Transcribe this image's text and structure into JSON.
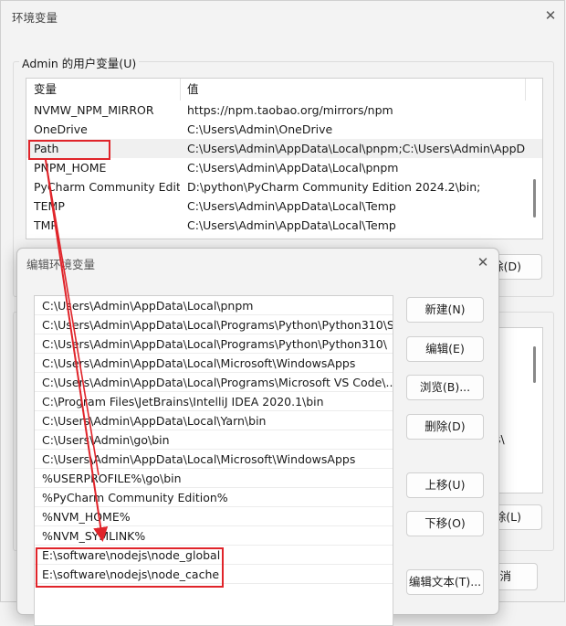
{
  "main_window": {
    "title": "环境变量",
    "user_group_label": "Admin 的用户变量(U)",
    "columns": {
      "name": "变量",
      "value": "值"
    },
    "user_vars": [
      {
        "name": "NVMW_NPM_MIRROR",
        "value": "https://npm.taobao.org/mirrors/npm"
      },
      {
        "name": "OneDrive",
        "value": "C:\\Users\\Admin\\OneDrive"
      },
      {
        "name": "Path",
        "value": "C:\\Users\\Admin\\AppData\\Local\\pnpm;C:\\Users\\Admin\\AppD..."
      },
      {
        "name": "PNPM_HOME",
        "value": "C:\\Users\\Admin\\AppData\\Local\\pnpm"
      },
      {
        "name": "PyCharm Community Editi...",
        "value": "D:\\python\\PyCharm Community Edition 2024.2\\bin;"
      },
      {
        "name": "TEMP",
        "value": "C:\\Users\\Admin\\AppData\\Local\\Temp"
      },
      {
        "name": "TMP",
        "value": "C:\\Users\\Admin\\AppData\\Local\\Temp"
      }
    ],
    "partial_buttons": {
      "delete_user": "除(D)",
      "delete_system": "除(L)",
      "cancel": "消"
    },
    "partial_text": "s\\"
  },
  "edit_dialog": {
    "title": "编辑环境变量",
    "paths": [
      "C:\\Users\\Admin\\AppData\\Local\\pnpm",
      "C:\\Users\\Admin\\AppData\\Local\\Programs\\Python\\Python310\\Sc...",
      "C:\\Users\\Admin\\AppData\\Local\\Programs\\Python\\Python310\\",
      "C:\\Users\\Admin\\AppData\\Local\\Microsoft\\WindowsApps",
      "C:\\Users\\Admin\\AppData\\Local\\Programs\\Microsoft VS Code\\...",
      "C:\\Program Files\\JetBrains\\IntelliJ IDEA 2020.1\\bin",
      "C:\\Users\\Admin\\AppData\\Local\\Yarn\\bin",
      "C:\\Users\\Admin\\go\\bin",
      "C:\\Users\\Admin\\AppData\\Local\\Microsoft\\WindowsApps",
      "%USERPROFILE%\\go\\bin",
      "%PyCharm Community Edition%",
      "%NVM_HOME%",
      "%NVM_SYMLINK%",
      "E:\\software\\nodejs\\node_global",
      "E:\\software\\nodejs\\node_cache"
    ],
    "buttons": {
      "new": "新建(N)",
      "edit": "编辑(E)",
      "browse": "浏览(B)...",
      "delete": "删除(D)",
      "move_up": "上移(U)",
      "move_down": "下移(O)",
      "edit_text": "编辑文本(T)..."
    }
  },
  "colors": {
    "annotation": "#e0242a"
  }
}
